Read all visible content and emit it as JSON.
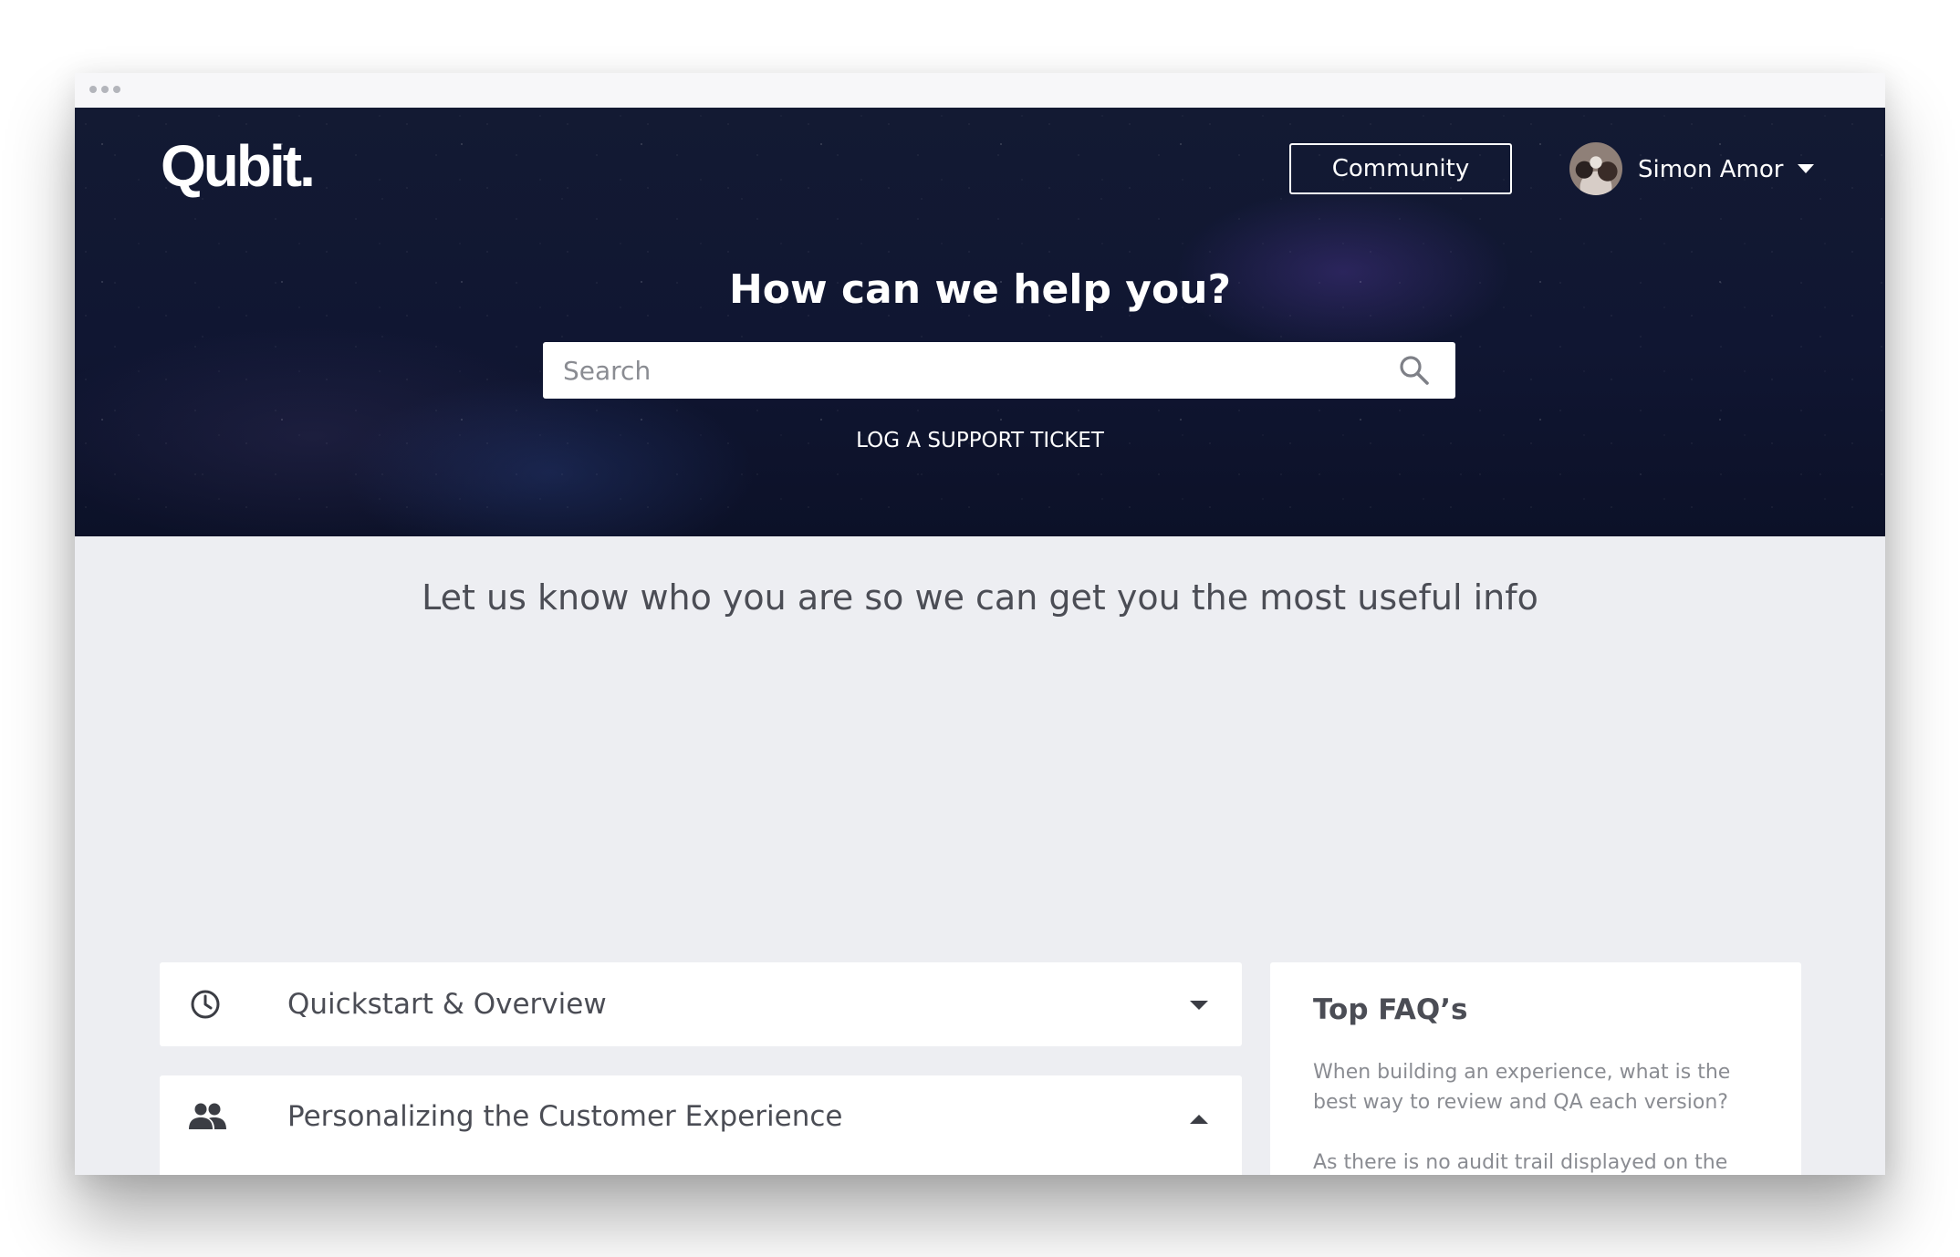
{
  "header": {
    "logo_text": "Qubit.",
    "community_label": "Community",
    "user_name": "Simon Amor"
  },
  "hero": {
    "title": "How can we help you?",
    "search_placeholder": "Search",
    "ticket_link": "LOG A SUPPORT TICKET"
  },
  "main": {
    "subtitle": "Let us know who you are so we can get you the most useful info",
    "sections": [
      {
        "title": "Quickstart & Overview",
        "icon": "clock-icon",
        "expanded": false
      },
      {
        "title": "Personalizing the Customer Experience",
        "icon": "people-icon",
        "expanded": true
      }
    ]
  },
  "faq": {
    "title": "Top FAQ’s",
    "questions": [
      "When building an experience, what is the best way to review and QA each version?",
      "As there is no audit trail displayed on the"
    ]
  },
  "colors": {
    "hero_background": "#111833",
    "page_background": "#edeef2",
    "text_dark": "#4b4d55",
    "text_muted": "#8a8c92"
  }
}
